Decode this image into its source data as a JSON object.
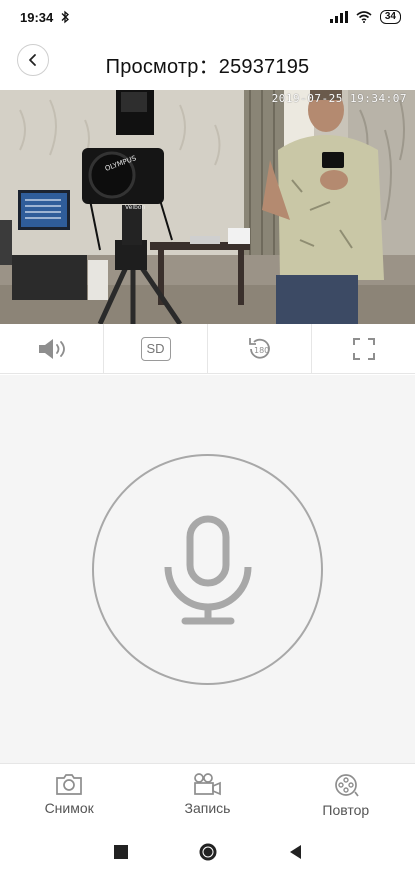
{
  "status_bar": {
    "time": "19:34",
    "battery": "34",
    "icons": [
      "bluetooth-icon",
      "signal-icon",
      "wifi-icon",
      "battery-icon"
    ]
  },
  "header": {
    "title": "Просмотр：25937195",
    "back_icon": "chevron-left-icon"
  },
  "video": {
    "timestamp": "2019-07-25 19:34:07",
    "camera_brand_text": "Velbon",
    "camera_strap_text": "OLYMPUS"
  },
  "controls": [
    {
      "name": "sound-button",
      "icon": "speaker-icon"
    },
    {
      "name": "quality-button",
      "label": "SD"
    },
    {
      "name": "rotate-button",
      "icon": "rotate-180-icon",
      "label": "180"
    },
    {
      "name": "fullscreen-button",
      "icon": "fullscreen-icon"
    }
  ],
  "talk": {
    "icon": "microphone-icon"
  },
  "bottom_bar": {
    "snapshot_label": "Снимок",
    "record_label": "Запись",
    "playback_label": "Повтор"
  },
  "colors": {
    "icon_gray": "#8e8e8e",
    "talk_bg": "#f5f5f5",
    "ring": "#a8a8a8"
  }
}
